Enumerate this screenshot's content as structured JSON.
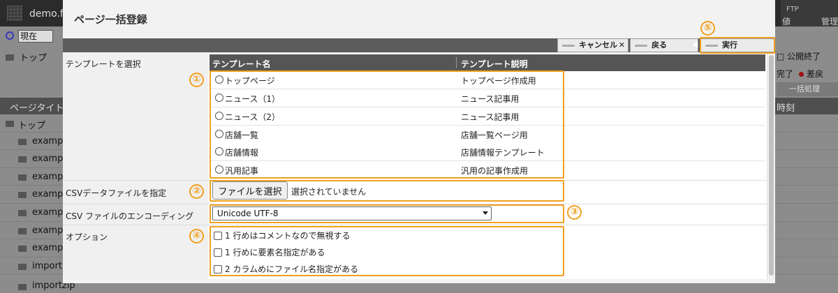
{
  "background": {
    "site_name": "demo.f",
    "ftp_label": "FTP",
    "manage_label": "管理",
    "ti_label": "値",
    "time_select": "現在",
    "tree_top": "トップ",
    "right_published_end": "公開終了",
    "right_completed": "完了",
    "right_diff": "差戻",
    "bulk_button": "一括処理",
    "col_page_title": "ページタイト",
    "col_time": "時刻",
    "rows": [
      {
        "label": "トップ"
      },
      {
        "label": "exampl"
      },
      {
        "label": "exampl"
      },
      {
        "label": "exampl"
      },
      {
        "label": "exampl"
      },
      {
        "label": "exampl"
      },
      {
        "label": "exampl"
      },
      {
        "label": "exampl"
      },
      {
        "label": "import."
      }
    ],
    "bottom_row": "importzip"
  },
  "modal": {
    "title": "ページ一括登録",
    "toolbar": {
      "cancel_label": "キャンセル",
      "cancel_x": "✕",
      "back_label": "戻る",
      "execute_label": "実行"
    },
    "template_section": {
      "label": "テンプレートを選択",
      "header_name": "テンプレート名",
      "header_desc": "テンプレート説明",
      "rows": [
        {
          "name": "トップページ",
          "desc": "トップページ作成用"
        },
        {
          "name": "ニュース（1）",
          "desc": "ニュース記事用"
        },
        {
          "name": "ニュース（2）",
          "desc": "ニュース記事用"
        },
        {
          "name": "店舗一覧",
          "desc": "店舗一覧ページ用"
        },
        {
          "name": "店舗情報",
          "desc": "店舗情報テンプレート"
        },
        {
          "name": "汎用記事",
          "desc": "汎用の記事作成用"
        }
      ]
    },
    "csv_section": {
      "label": "CSVデータファイルを指定",
      "button_label": "ファイルを選択",
      "status_text": "選択されていません"
    },
    "encoding_section": {
      "label": "CSV ファイルのエンコーディング",
      "selected": "Unicode UTF-8"
    },
    "options_section": {
      "label": "オプション",
      "options": [
        {
          "label": "1 行めはコメントなので無視する",
          "checked": false
        },
        {
          "label": "1 行めに要素名指定がある",
          "checked": false
        },
        {
          "label": "2 カラムめにファイル名指定がある",
          "checked": false
        }
      ]
    },
    "annotations": [
      "①",
      "②",
      "③",
      "④",
      "⑤"
    ],
    "annotation_color": "#f0a020"
  }
}
